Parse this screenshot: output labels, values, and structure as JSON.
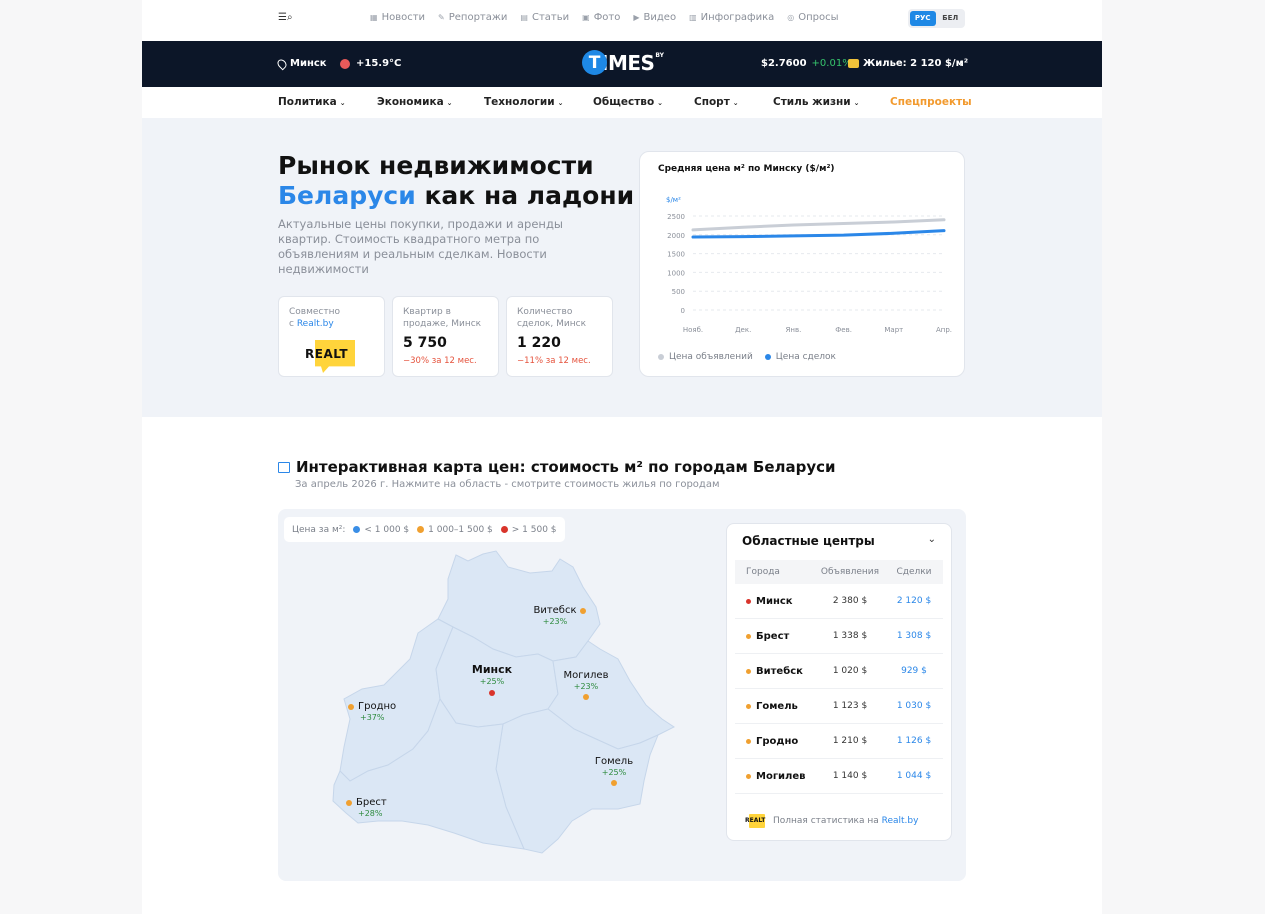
{
  "topnav": {
    "items": [
      {
        "icon": "news-icon",
        "glyph": "▦",
        "label": "Новости"
      },
      {
        "icon": "reports-icon",
        "glyph": "✎",
        "label": "Репортажи"
      },
      {
        "icon": "articles-icon",
        "glyph": "▤",
        "label": "Статьи"
      },
      {
        "icon": "photo-icon",
        "glyph": "▣",
        "label": "Фото"
      },
      {
        "icon": "video-icon",
        "glyph": "▶",
        "label": "Видео"
      },
      {
        "icon": "infographic-icon",
        "glyph": "▥",
        "label": "Инфографика"
      },
      {
        "icon": "polls-icon",
        "glyph": "◎",
        "label": "Опросы"
      }
    ],
    "lang": {
      "ru": "РУС",
      "be": "БЕЛ",
      "active": "РУС"
    }
  },
  "darkbar": {
    "city": "Минск",
    "temp": "+15.9°C",
    "logo_letter": "T",
    "logo_text": "IMES",
    "logo_suffix": "BY",
    "usd_rate": "$2.7600",
    "usd_change": "+0.01%",
    "housing": "Жилье: 2 120 $/м²"
  },
  "categories": [
    {
      "label": "Политика",
      "dropdown": true
    },
    {
      "label": "Экономика",
      "dropdown": true
    },
    {
      "label": "Технологии",
      "dropdown": true
    },
    {
      "label": "Общество",
      "dropdown": true
    },
    {
      "label": "Спорт",
      "dropdown": true
    },
    {
      "label": "Стиль жизни",
      "dropdown": true
    },
    {
      "label": "Спецпроекты",
      "dropdown": false
    }
  ],
  "hero": {
    "title_line1": "Рынок недвижимости",
    "title_blue": "Беларуси",
    "title_rest": " как на ладони",
    "subtitle": "Актуальные цены покупки, продажи и аренды квартир. Стоимость квадратного метра по объявлениям и реальным сделкам. Новости недвижимости",
    "partner": {
      "label": "Совместно",
      "label2": "с ",
      "link": "Realt.by",
      "logo_text": "REALT"
    },
    "stats": [
      {
        "label": "Квартир в продаже, Минск",
        "value": "5 750",
        "change": "−30% за 12 мес."
      },
      {
        "label": "Количество сделок, Минск",
        "value": "1 220",
        "change": "−11% за 12 мес."
      }
    ]
  },
  "chart_data": {
    "type": "line",
    "title": "Средняя цена м² по Минску ($/м²)",
    "ylabel": "$/м²",
    "ylim": [
      0,
      2500
    ],
    "yticks": [
      0,
      500,
      1000,
      1500,
      2000,
      2500
    ],
    "categories": [
      "Нояб.",
      "Дек.",
      "Янв.",
      "Фев.",
      "Март",
      "Апр."
    ],
    "series": [
      {
        "name": "Цена объявлений",
        "color": "#c9ced6",
        "values": [
          2130,
          2200,
          2260,
          2300,
          2340,
          2400
        ]
      },
      {
        "name": "Цена сделок",
        "color": "#2b87e8",
        "values": [
          1940,
          1950,
          1970,
          1990,
          2040,
          2110
        ]
      }
    ],
    "legend_position": "bottom-left",
    "grid": true
  },
  "map": {
    "title": "Интерактивная карта цен: стоимость м² по городам Беларуси",
    "subtitle": "За апрель 2026 г. Нажмите на область - смотрите стоимость жилья по городам",
    "legend_label": "Цена за м²:",
    "legend": [
      {
        "label": "< 1 000 $",
        "color": "#3a8ee6"
      },
      {
        "label": "1 000–1 500 $",
        "color": "#f0a030"
      },
      {
        "label": "> 1 500 $",
        "color": "#d9342b"
      }
    ],
    "cities": [
      {
        "name": "Витебск",
        "change": "+23%",
        "color": "#f0a030"
      },
      {
        "name": "Минск",
        "change": "+25%",
        "color": "#d9342b"
      },
      {
        "name": "Могилев",
        "change": "+23%",
        "color": "#f0a030"
      },
      {
        "name": "Гродно",
        "change": "+37%",
        "color": "#f0a030"
      },
      {
        "name": "Гомель",
        "change": "+25%",
        "color": "#f0a030"
      },
      {
        "name": "Брест",
        "change": "+28%",
        "color": "#f0a030"
      }
    ]
  },
  "centers": {
    "title": "Областные центры",
    "headers": [
      "Города",
      "Объявления",
      "Сделки"
    ],
    "rows": [
      {
        "city": "Минск",
        "color": "#d9342b",
        "listings": "2 380 $",
        "deals": "2 120 $"
      },
      {
        "city": "Брест",
        "color": "#f0a030",
        "listings": "1 338 $",
        "deals": "1 308 $"
      },
      {
        "city": "Витебск",
        "color": "#f0a030",
        "listings": "1 020 $",
        "deals": "929 $"
      },
      {
        "city": "Гомель",
        "color": "#f0a030",
        "listings": "1 123 $",
        "deals": "1 030 $"
      },
      {
        "city": "Гродно",
        "color": "#f0a030",
        "listings": "1 210 $",
        "deals": "1 126 $"
      },
      {
        "city": "Могилев",
        "color": "#f0a030",
        "listings": "1 140 $",
        "deals": "1 044 $"
      }
    ],
    "footer_text": "Полная статистика на ",
    "footer_link": "Realt.by",
    "footer_logo": "REALT"
  }
}
